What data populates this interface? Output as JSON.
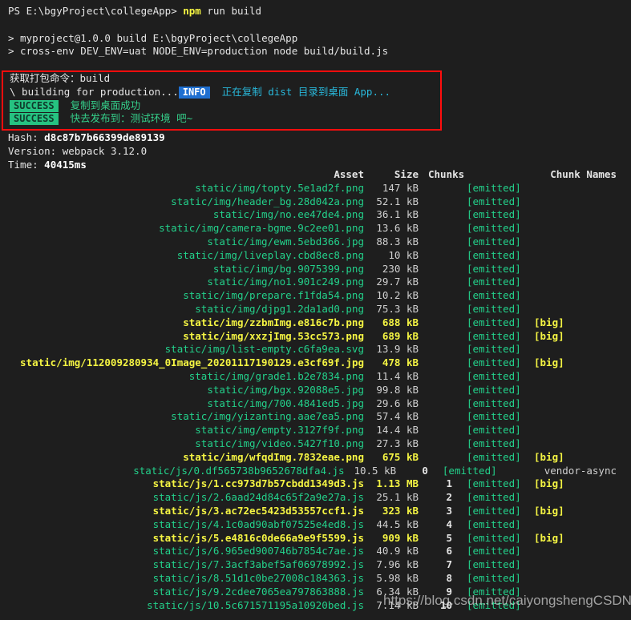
{
  "terminal": {
    "prompt_line": {
      "prompt": "PS E:\\bgyProject\\collegeApp>",
      "command_highlight": "npm",
      "command_rest": " run build"
    },
    "npm_lines": [
      "> myproject@1.0.0 build E:\\bgyProject\\collegeApp",
      "> cross-env DEV_ENV=uat NODE_ENV=production node build/build.js"
    ],
    "highlight_box": {
      "line1": "获取打包命令：build",
      "line2_prefix": "\\ building for production...",
      "info_badge": "INFO",
      "info_message": "正在复制 dist 目录到桌面 App...",
      "success_badge": "SUCCESS",
      "success_message_1": "复制到桌面成功",
      "success_message_2": "快去发布到：测试环境 吧~"
    },
    "stats": {
      "hash_label": "Hash:",
      "hash_value": "d8c87b7b66399de89139",
      "version_label": "Version:",
      "version_value": "webpack 3.12.0",
      "time_label": "Time:",
      "time_value": "40415ms"
    },
    "table": {
      "headers": {
        "asset": "Asset",
        "size": "Size",
        "chunks": "Chunks",
        "chunk_names": "Chunk Names"
      },
      "emitted_label": "[emitted]",
      "big_label": "[big]",
      "rows": [
        {
          "asset": "static/img/topty.5e1ad2f.png",
          "size": "147 kB",
          "chunks": "",
          "emitted": true,
          "big": false,
          "names": ""
        },
        {
          "asset": "static/img/header_bg.28d042a.png",
          "size": "52.1 kB",
          "chunks": "",
          "emitted": true,
          "big": false,
          "names": ""
        },
        {
          "asset": "static/img/no.ee47de4.png",
          "size": "36.1 kB",
          "chunks": "",
          "emitted": true,
          "big": false,
          "names": ""
        },
        {
          "asset": "static/img/camera-bgme.9c2ee01.png",
          "size": "13.6 kB",
          "chunks": "",
          "emitted": true,
          "big": false,
          "names": ""
        },
        {
          "asset": "static/img/ewm.5ebd366.jpg",
          "size": "88.3 kB",
          "chunks": "",
          "emitted": true,
          "big": false,
          "names": ""
        },
        {
          "asset": "static/img/liveplay.cbd8ec8.png",
          "size": "10 kB",
          "chunks": "",
          "emitted": true,
          "big": false,
          "names": ""
        },
        {
          "asset": "static/img/bg.9075399.png",
          "size": "230 kB",
          "chunks": "",
          "emitted": true,
          "big": false,
          "names": ""
        },
        {
          "asset": "static/img/no1.901c249.png",
          "size": "29.7 kB",
          "chunks": "",
          "emitted": true,
          "big": false,
          "names": ""
        },
        {
          "asset": "static/img/prepare.f1fda54.png",
          "size": "10.2 kB",
          "chunks": "",
          "emitted": true,
          "big": false,
          "names": ""
        },
        {
          "asset": "static/img/djpg1.2da1ad0.png",
          "size": "75.3 kB",
          "chunks": "",
          "emitted": true,
          "big": false,
          "names": ""
        },
        {
          "asset": "static/img/zzbmImg.e816c7b.png",
          "size": "688 kB",
          "chunks": "",
          "emitted": true,
          "big": true,
          "names": ""
        },
        {
          "asset": "static/img/xxzjImg.53cc573.png",
          "size": "689 kB",
          "chunks": "",
          "emitted": true,
          "big": true,
          "names": ""
        },
        {
          "asset": "static/img/list-empty.c6fa9ea.svg",
          "size": "13.9 kB",
          "chunks": "",
          "emitted": true,
          "big": false,
          "names": ""
        },
        {
          "asset": "static/img/112009280934_0Image_20201117190129.e3cf69f.jpg",
          "size": "478 kB",
          "chunks": "",
          "emitted": true,
          "big": true,
          "names": ""
        },
        {
          "asset": "static/img/grade1.b2e7834.png",
          "size": "11.4 kB",
          "chunks": "",
          "emitted": true,
          "big": false,
          "names": ""
        },
        {
          "asset": "static/img/bgx.92088e5.jpg",
          "size": "99.8 kB",
          "chunks": "",
          "emitted": true,
          "big": false,
          "names": ""
        },
        {
          "asset": "static/img/700.4841ed5.jpg",
          "size": "29.6 kB",
          "chunks": "",
          "emitted": true,
          "big": false,
          "names": ""
        },
        {
          "asset": "static/img/yizanting.aae7ea5.png",
          "size": "57.4 kB",
          "chunks": "",
          "emitted": true,
          "big": false,
          "names": ""
        },
        {
          "asset": "static/img/empty.3127f9f.png",
          "size": "14.4 kB",
          "chunks": "",
          "emitted": true,
          "big": false,
          "names": ""
        },
        {
          "asset": "static/img/video.5427f10.png",
          "size": "27.3 kB",
          "chunks": "",
          "emitted": true,
          "big": false,
          "names": ""
        },
        {
          "asset": "static/img/wfqdImg.7832eae.png",
          "size": "675 kB",
          "chunks": "",
          "emitted": true,
          "big": true,
          "names": ""
        },
        {
          "asset": "static/js/0.df565738b9652678dfa4.js",
          "size": "10.5 kB",
          "chunks": "0",
          "emitted": true,
          "big": false,
          "names": "vendor-async"
        },
        {
          "asset": "static/js/1.cc973d7b57cbdd1349d3.js",
          "size": "1.13 MB",
          "chunks": "1",
          "emitted": true,
          "big": true,
          "names": ""
        },
        {
          "asset": "static/js/2.6aad24d84c65f2a9e27a.js",
          "size": "25.1 kB",
          "chunks": "2",
          "emitted": true,
          "big": false,
          "names": ""
        },
        {
          "asset": "static/js/3.ac72ec5423d53557ccf1.js",
          "size": "323 kB",
          "chunks": "3",
          "emitted": true,
          "big": true,
          "names": ""
        },
        {
          "asset": "static/js/4.1c0ad90abf07525e4ed8.js",
          "size": "44.5 kB",
          "chunks": "4",
          "emitted": true,
          "big": false,
          "names": ""
        },
        {
          "asset": "static/js/5.e4816c0de66a9e9f5599.js",
          "size": "909 kB",
          "chunks": "5",
          "emitted": true,
          "big": true,
          "names": ""
        },
        {
          "asset": "static/js/6.965ed900746b7854c7ae.js",
          "size": "40.9 kB",
          "chunks": "6",
          "emitted": true,
          "big": false,
          "names": ""
        },
        {
          "asset": "static/js/7.3acf3abef5af06978992.js",
          "size": "7.96 kB",
          "chunks": "7",
          "emitted": true,
          "big": false,
          "names": ""
        },
        {
          "asset": "static/js/8.51d1c0be27008c184363.js",
          "size": "5.98 kB",
          "chunks": "8",
          "emitted": true,
          "big": false,
          "names": ""
        },
        {
          "asset": "static/js/9.2cdee7065ea797863888.js",
          "size": "6.34 kB",
          "chunks": "9",
          "emitted": true,
          "big": false,
          "names": ""
        },
        {
          "asset": "static/js/10.5c671571195a10920bed.js",
          "size": "7.14 kB",
          "chunks": "10",
          "emitted": true,
          "big": false,
          "names": ""
        }
      ]
    }
  },
  "watermark": "https://blog.csdn.net/caiyongshengCSDN",
  "colors": {
    "background": "#1e1e1e",
    "green": "#23d18b",
    "yellow": "#f5f543",
    "cyan": "#29b8db",
    "info_badge_bg": "#1f6fd0",
    "success_badge_bg": "#26c281",
    "highlight_border": "#ff0d0d"
  }
}
